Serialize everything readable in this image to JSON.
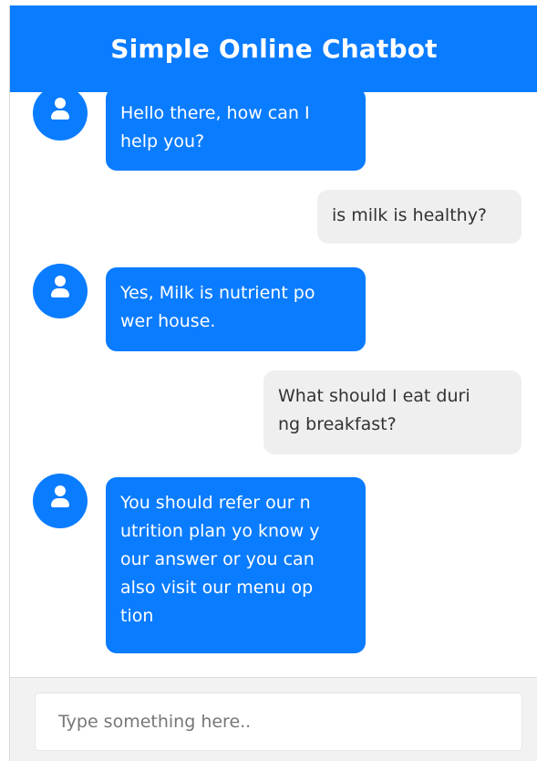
{
  "header": {
    "title": "Simple Online Chatbot"
  },
  "messages": [
    {
      "sender": "bot",
      "icon": "user-icon",
      "text": "Hello there, how can I\nhelp you?"
    },
    {
      "sender": "user",
      "text": "is milk is healthy?"
    },
    {
      "sender": "bot",
      "icon": "user-icon",
      "text": "Yes, Milk is nutrient po\nwer house."
    },
    {
      "sender": "user",
      "text": "What should I eat duri\nng breakfast?"
    },
    {
      "sender": "bot",
      "icon": "user-icon",
      "text": "You should refer our n\nutrition plan yo know y\nour answer or you can\nalso visit our menu op\ntion"
    }
  ],
  "input": {
    "placeholder": "Type something here..",
    "value": ""
  },
  "colors": {
    "accent": "#0a7cff",
    "user_bubble": "#efefef",
    "input_bar": "#f2f2f2"
  }
}
